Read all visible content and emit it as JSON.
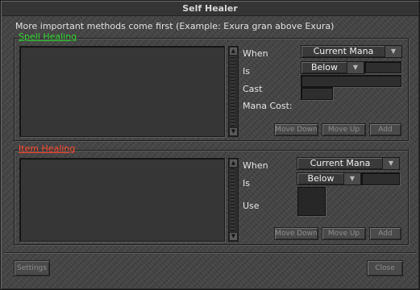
{
  "window": {
    "title": "Self Healer"
  },
  "info_text": "More important methods come first (Example: Exura gran above Exura)",
  "spell_healing": {
    "title": "Spell Healing",
    "labels": {
      "when": "When",
      "is": "Is",
      "cast": "Cast",
      "mana_cost": "Mana Cost:"
    },
    "when_value": "Current Mana",
    "is_value": "Below",
    "buttons": {
      "move_down": "Move Down",
      "move_up": "Move Up",
      "add": "Add"
    }
  },
  "item_healing": {
    "title": "Item Healing",
    "labels": {
      "when": "When",
      "is": "Is",
      "use": "Use"
    },
    "when_value": "Current Mana",
    "is_value": "Below",
    "buttons": {
      "move_down": "Move Down",
      "move_up": "Move Up",
      "add": "Add"
    }
  },
  "footer": {
    "settings": "Settings",
    "close": "Close"
  },
  "colors": {
    "spell_title": "#2fd42f",
    "item_title": "#ff4a2f",
    "background": "#454545"
  },
  "icons": [
    "chevron-down-icon",
    "scroll-up-arrow-icon",
    "scroll-down-arrow-icon"
  ]
}
